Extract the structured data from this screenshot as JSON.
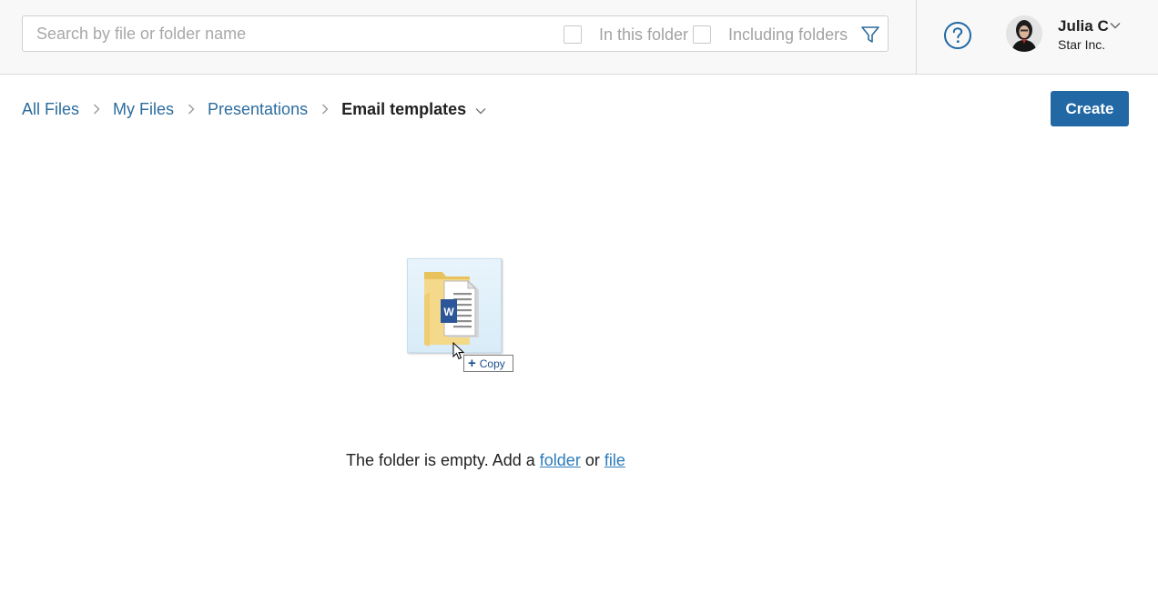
{
  "search": {
    "placeholder": "Search by file or folder name",
    "in_this_folder_label": "In this folder",
    "including_folders_label": "Including folders"
  },
  "user": {
    "name": "Julia C",
    "org": "Star Inc."
  },
  "breadcrumb": {
    "items": [
      {
        "label": "All Files"
      },
      {
        "label": "My Files"
      },
      {
        "label": "Presentations"
      }
    ],
    "current": "Email templates"
  },
  "toolbar": {
    "create_label": "Create"
  },
  "drag": {
    "tooltip_label": "Copy",
    "icon": "word-file-in-folder-icon"
  },
  "empty_state": {
    "prefix": "The folder is empty. Add a ",
    "folder_link": "folder",
    "or_text": " or ",
    "file_link": "file"
  },
  "colors": {
    "accent": "#2168a5",
    "link": "#2c6c9d",
    "word_blue": "#2b579a",
    "folder_yellow": "#f3d37c"
  }
}
